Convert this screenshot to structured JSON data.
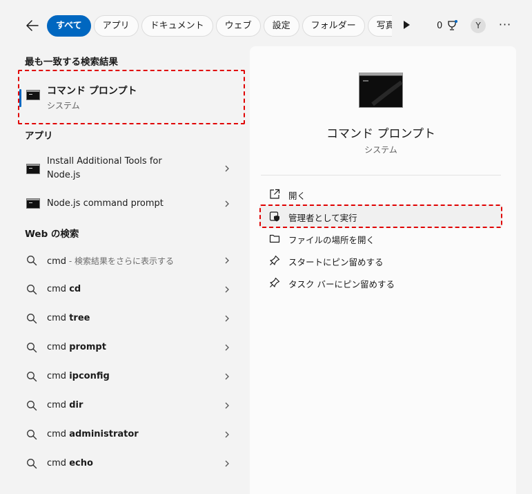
{
  "topbar": {
    "filters": [
      "すべて",
      "アプリ",
      "ドキュメント",
      "ウェブ",
      "設定",
      "フォルダー",
      "写真"
    ],
    "points": "0",
    "avatar_initial": "Y",
    "more": "···"
  },
  "best_match": {
    "section_title": "最も一致する検索結果",
    "name": "コマンド プロンプト",
    "type": "システム"
  },
  "apps": {
    "section_title": "アプリ",
    "items": [
      {
        "label_line1": "Install Additional Tools for",
        "label_line2": "Node.js"
      },
      {
        "label_line1": "Node.js command prompt"
      }
    ]
  },
  "web": {
    "section_title": "Web の検索",
    "first": {
      "prefix": "cmd",
      "hint": " - 検索結果をさらに表示する"
    },
    "items": [
      {
        "prefix": "cmd ",
        "bold": "cd"
      },
      {
        "prefix": "cmd ",
        "bold": "tree"
      },
      {
        "prefix": "cmd ",
        "bold": "prompt"
      },
      {
        "prefix": "cmd ",
        "bold": "ipconfig"
      },
      {
        "prefix": "cmd ",
        "bold": "dir"
      },
      {
        "prefix": "cmd ",
        "bold": "administrator"
      },
      {
        "prefix": "cmd ",
        "bold": "echo"
      }
    ]
  },
  "detail": {
    "title": "コマンド プロンプト",
    "subtitle": "システム",
    "actions": [
      {
        "label": "開く",
        "icon": "open-external-icon"
      },
      {
        "label": "管理者として実行",
        "icon": "shield-admin-icon"
      },
      {
        "label": "ファイルの場所を開く",
        "icon": "folder-icon"
      },
      {
        "label": "スタートにピン留めする",
        "icon": "pin-icon"
      },
      {
        "label": "タスク バーにピン留めする",
        "icon": "pin-icon"
      }
    ]
  },
  "colors": {
    "accent": "#0067c0",
    "highlight_dash": "#e00000",
    "background": "#f3f3f3",
    "panel": "#fbfbfb"
  }
}
